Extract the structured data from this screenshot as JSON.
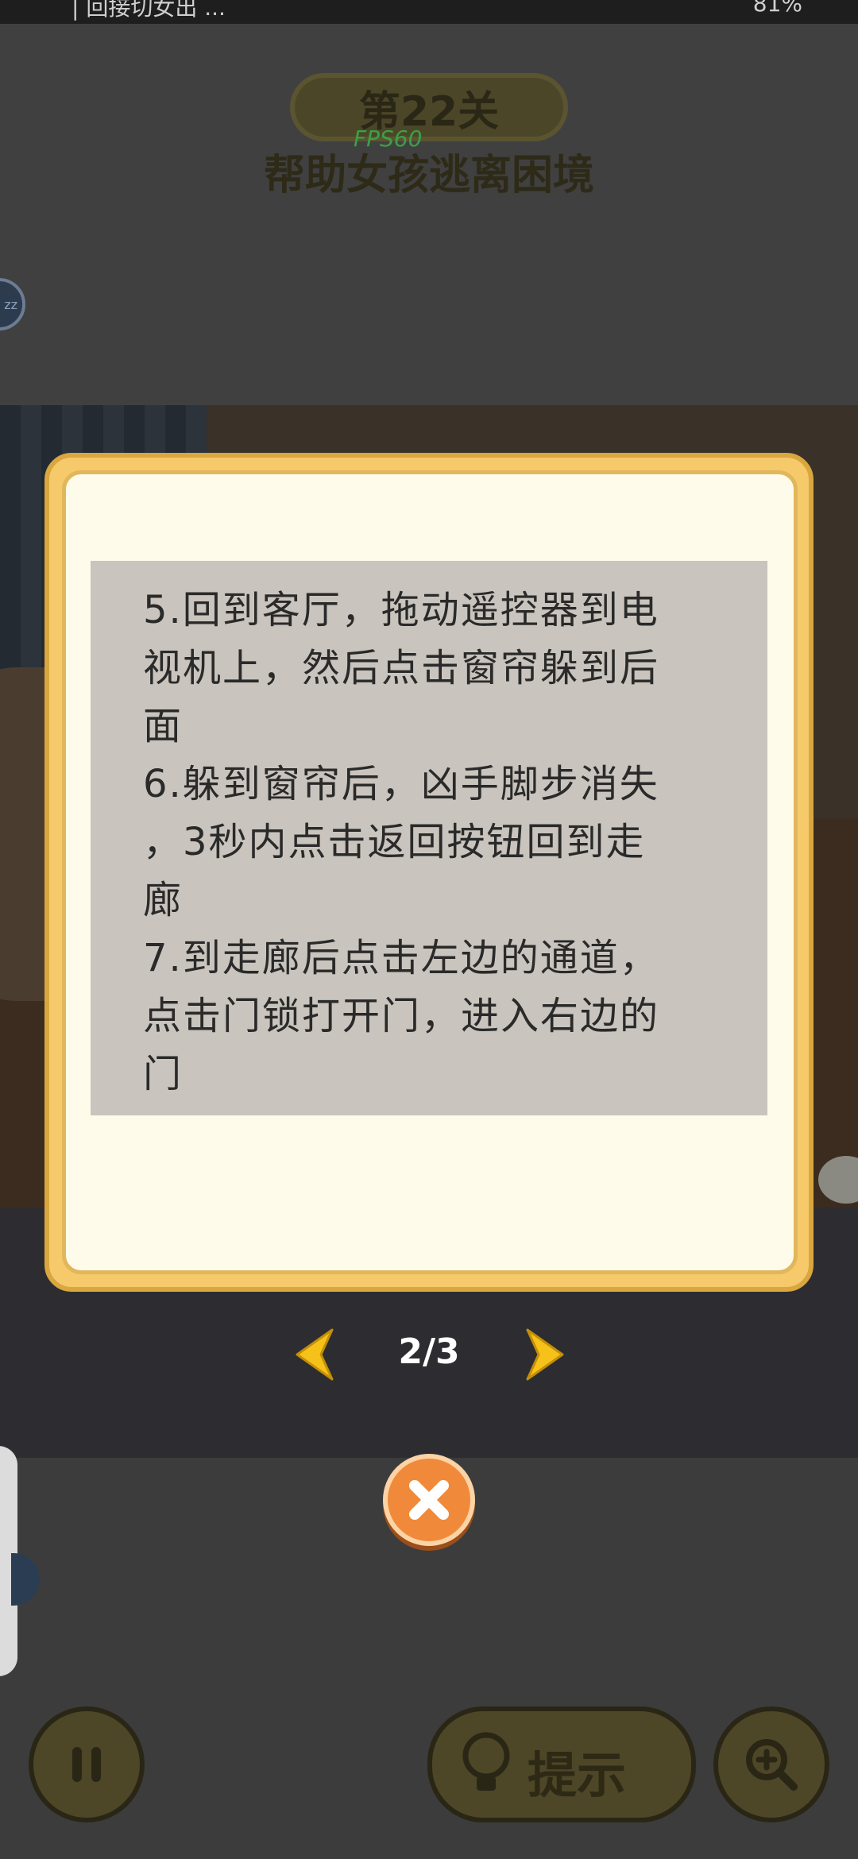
{
  "status_bar": {
    "left_text": "| 回接切女出 ...",
    "right_text": "81%"
  },
  "level": {
    "badge": "第22关",
    "title": "帮助女孩逃离困境",
    "fps": "FPS60"
  },
  "side_bubble_text": "zz",
  "hint": {
    "lines": [
      "5.回到客厅，拖动遥控器到电",
      "视机上，然后点击窗帘躲到后",
      "面",
      "6.躲到窗帘后，凶手脚步消失",
      "，3秒内点击返回按钮回到走",
      "廊",
      "7.到走廊后点击左边的通道，",
      "点击门锁打开门，进入右边的",
      "门"
    ]
  },
  "pagination": {
    "current": 2,
    "total": 3,
    "label": "2/3"
  },
  "bottom": {
    "hint_button_label": "提示"
  },
  "icons": {
    "prev": "chevron-left-icon",
    "next": "chevron-right-icon",
    "close": "close-icon",
    "pause": "pause-icon",
    "bulb": "lightbulb-icon",
    "zoom": "zoom-in-icon"
  },
  "colors": {
    "arrow": "#f6c21a",
    "close": "#f08a3a",
    "card_border": "#f6c96a",
    "card_bg": "#fefbea",
    "paper": "#c9c4bd"
  }
}
